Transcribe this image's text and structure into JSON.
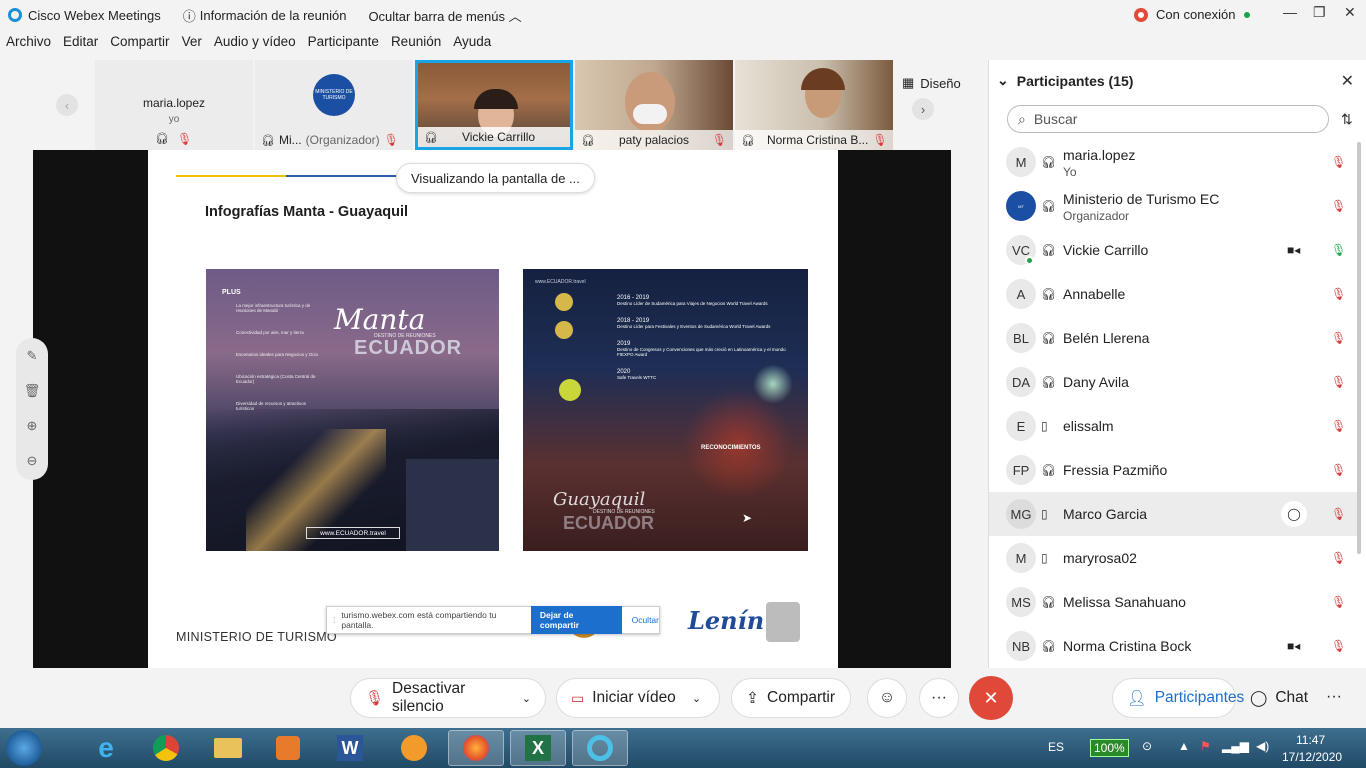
{
  "titlebar": {
    "app_title": "Cisco Webex Meetings",
    "meeting_info": "Información de la reunión",
    "hide_menu": "Ocultar barra de menús",
    "connection": "Con conexión"
  },
  "menu": [
    "Archivo",
    "Editar",
    "Compartir",
    "Ver",
    "Audio y vídeo",
    "Participante",
    "Reunión",
    "Ayuda"
  ],
  "thumbnails": [
    {
      "name": "maria.lopez",
      "sub": "yo"
    },
    {
      "name": "Mi...",
      "role": "(Organizador)",
      "logo_text": "MINISTERIO DE TURISMO"
    },
    {
      "name": "Vickie Carrillo"
    },
    {
      "name": "paty palacios"
    },
    {
      "name": "Norma Cristina B..."
    }
  ],
  "layout_button": "Diseño",
  "viewing_pill": "Visualizando la pantalla de ...",
  "slide": {
    "title": "Infografías Manta  - Guayaquil",
    "footer_left": "MINISTERIO DE TURISMO",
    "footer_sign": "Lenín",
    "left_poster": {
      "plus": "PLUS",
      "script": "Manta",
      "dest": "DESTINO DE REUNIONES",
      "country": "ECUADOR",
      "url": "www.ECUADOR.travel",
      "items": [
        "La mejor infraestructura turística y de reuniones de Manabí",
        "Conectividad por aire, mar y tierra",
        "Escenarios ideales para Negocios y Ocio",
        "Ubicación estratégica (Costa Central de Ecuador)",
        "Diversidad de recursos y atractivos turísticos"
      ]
    },
    "right_poster": {
      "url": "www.ECUADOR.travel",
      "awards": [
        {
          "years": "2016 - 2019",
          "text": "Destino Líder de Sudamérica para Viajes de Negocios World Travel Awards"
        },
        {
          "years": "2018 - 2019",
          "text": "Destino Líder para Festivales y Eventos de Sudamérica World Travel Awards"
        },
        {
          "years": "2019",
          "text": "Destino de Congresos y Convenciones que más creció en Latinoamérica y el mundo FIEXPO Award"
        },
        {
          "years": "2020",
          "text": "Safe Travels WTTC"
        }
      ],
      "recognition": "RECONOCIMIENTOS",
      "script": "Guayaquil",
      "dest": "DESTINO DE REUNIONES",
      "country": "ECUADOR"
    }
  },
  "share_notice": {
    "text": "turismo.webex.com está compartiendo tu pantalla.",
    "stop": "Dejar de compartir",
    "hide": "Ocultar"
  },
  "panel": {
    "title": "Participantes (15)",
    "search_placeholder": "Buscar",
    "participants": [
      {
        "initials": "M",
        "name": "maria.lopez",
        "role": "Yo",
        "device": "headset"
      },
      {
        "initials": "",
        "name": "Ministerio de Turismo EC",
        "role": "Organizador",
        "device": "headset"
      },
      {
        "initials": "VC",
        "name": "Vickie Carrillo",
        "role": "",
        "device": "headset",
        "video": true,
        "mic_on": true
      },
      {
        "initials": "A",
        "name": "Annabelle",
        "role": "",
        "device": "headset"
      },
      {
        "initials": "BL",
        "name": "Belén Llerena",
        "role": "",
        "device": "headset"
      },
      {
        "initials": "DA",
        "name": "Dany Avila",
        "role": "",
        "device": "headset"
      },
      {
        "initials": "E",
        "name": "elissalm",
        "role": "",
        "device": "phone"
      },
      {
        "initials": "FP",
        "name": "Fressia Pazmiño",
        "role": "",
        "device": "headset"
      },
      {
        "initials": "MG",
        "name": "Marco Garcia",
        "role": "",
        "device": "phone",
        "highlight": true
      },
      {
        "initials": "M",
        "name": "maryrosa02",
        "role": "",
        "device": "phone"
      },
      {
        "initials": "MS",
        "name": "Melissa Sanahuano",
        "role": "",
        "device": "headset"
      },
      {
        "initials": "NB",
        "name": "Norma Cristina Bock",
        "role": "",
        "device": "headset",
        "video": true
      }
    ]
  },
  "controls": {
    "mute": "Desactivar silencio",
    "video": "Iniciar vídeo",
    "share": "Compartir",
    "participants": "Participantes",
    "chat": "Chat"
  },
  "taskbar": {
    "lang": "ES",
    "battery": "100%",
    "time": "11:47",
    "date": "17/12/2020"
  },
  "colors": {
    "accent": "#1d6fce",
    "end_call": "#e0483a",
    "muted": "#d63b3b",
    "active_border": "#1ba3e8"
  }
}
